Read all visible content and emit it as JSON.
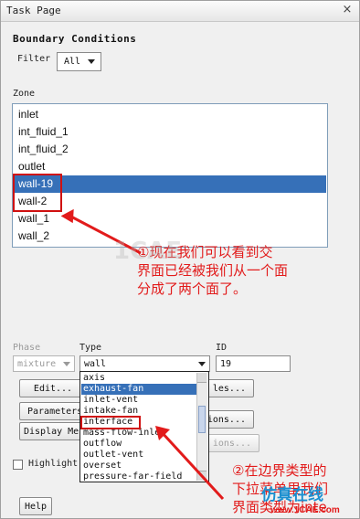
{
  "window": {
    "title": "Task Page",
    "close_glyph": "×"
  },
  "section_title": "Boundary Conditions",
  "filter": {
    "label": "Filter",
    "value": "All"
  },
  "zone": {
    "label": "Zone",
    "items": [
      "inlet",
      "int_fluid_1",
      "int_fluid_2",
      "outlet",
      "wall-19",
      "wall-2",
      "wall_1",
      "wall_2"
    ],
    "selected": "wall-19"
  },
  "annotation1": {
    "lines": [
      "①现在我们可以看到交",
      "界面已经被我们从一个面",
      "分成了两个面了。"
    ],
    "color": "#e21b1b"
  },
  "phase": {
    "label": "Phase",
    "value": "mixture"
  },
  "type": {
    "label": "Type",
    "value": "wall",
    "options": [
      "axis",
      "exhaust-fan",
      "inlet-vent",
      "intake-fan",
      "interface",
      "mass-flow-inlet",
      "outflow",
      "outlet-vent",
      "overset",
      "pressure-far-field"
    ],
    "highlighted": "exhaust-fan",
    "boxed": "interface"
  },
  "id": {
    "label": "ID",
    "value": "19"
  },
  "buttons": {
    "edit": "Edit...",
    "copy_partial": "les...",
    "parameters_partial": "Parameters",
    "operating_partial": "ions...",
    "display_partial": "Display Mes",
    "periodic_partial": "ions..."
  },
  "highlight_partial": "Highlight",
  "help": "Help",
  "annotation2": {
    "lines": [
      "②在边界类型的",
      "下拉菜单里我们",
      "界面类型为inte"
    ],
    "color": "#e21b1b"
  },
  "watermark": {
    "brand": "仿真在线",
    "url": "www.1CAE.com",
    "faint": "1CAE"
  },
  "colors": {
    "selection": "#3670b8",
    "annotation_red": "#e21b1b",
    "watermark_blue": "#1a8fd0"
  }
}
